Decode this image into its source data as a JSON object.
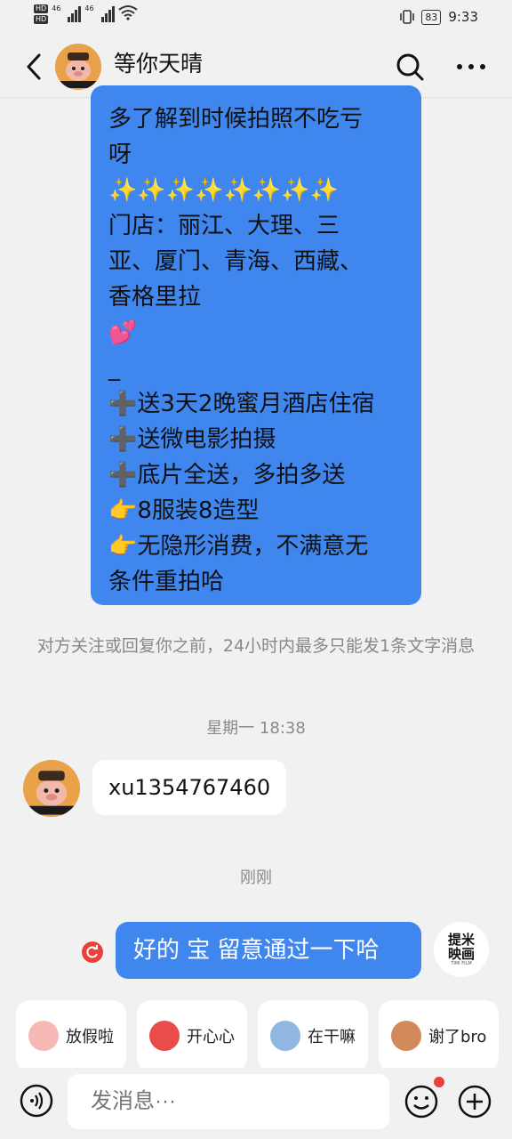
{
  "status_bar": {
    "time": "9:33",
    "battery": "83",
    "network_1": "46",
    "network_2": "46",
    "hd_1": "HD",
    "hd_2": "HD"
  },
  "header": {
    "title": "等你天晴"
  },
  "messages": {
    "long_message_lines": [
      "多了解到时候拍照不吃亏",
      "呀",
      "✨✨✨✨✨✨✨✨",
      "门店：丽江、大理、三",
      "亚、厦门、青海、西藏、",
      "香格里拉",
      "💕",
      "_",
      "➕送3天2晚蜜月酒店住宿",
      "➕送微电影拍摄",
      "➕底片全送，多拍多送",
      "👉8服装8造型",
      "👉无隐形消费，不满意无",
      "条件重拍哈"
    ],
    "notice": "对方关注或回复你之前，24小时内最多只能发1条文字消息",
    "time_1": "星期一 18:38",
    "peer_text": "xu1354767460",
    "time_2": "刚刚",
    "my_text": "好的  宝  留意通过一下哈"
  },
  "my_avatar": {
    "line1": "提米",
    "line2": "映画",
    "small": "TIMI FILM"
  },
  "quick_stickers": [
    {
      "label": "放假啦",
      "icon": "pig-sticker-icon",
      "color": "#f6b9b5"
    },
    {
      "label": "开心心",
      "icon": "heart-sticker-icon",
      "color": "#ea4b4b"
    },
    {
      "label": "在干嘛",
      "icon": "dog-sticker-icon",
      "color": "#8fb7df"
    },
    {
      "label": "谢了bro",
      "icon": "monkey-sticker-icon",
      "color": "#d28a5a"
    }
  ],
  "input": {
    "placeholder": "发消息···"
  },
  "colors": {
    "accent_blue": "#3f86ef",
    "badge_red": "#e8413c"
  }
}
